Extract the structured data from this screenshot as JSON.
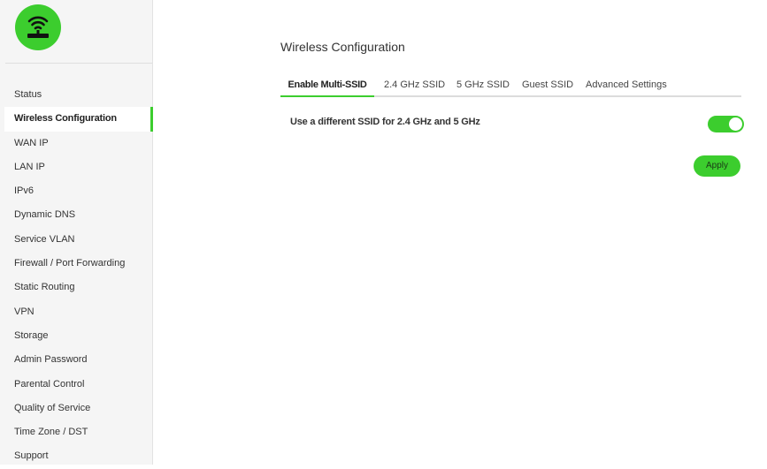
{
  "brand": {
    "logo_icon": "wifi-router-icon",
    "color": "#3ccd2e"
  },
  "sidebar": {
    "items": [
      {
        "label": "Status"
      },
      {
        "label": "Wireless Configuration",
        "active": true
      },
      {
        "label": "WAN IP"
      },
      {
        "label": "LAN IP"
      },
      {
        "label": "IPv6"
      },
      {
        "label": "Dynamic DNS"
      },
      {
        "label": "Service VLAN"
      },
      {
        "label": "Firewall / Port Forwarding"
      },
      {
        "label": "Static Routing"
      },
      {
        "label": "VPN"
      },
      {
        "label": "Storage"
      },
      {
        "label": "Admin Password"
      },
      {
        "label": "Parental Control"
      },
      {
        "label": "Quality of Service"
      },
      {
        "label": "Time Zone / DST"
      },
      {
        "label": "Support"
      }
    ]
  },
  "main": {
    "title": "Wireless Configuration",
    "tabs": [
      {
        "label": "Enable Multi-SSID",
        "active": true
      },
      {
        "label": "2.4 GHz SSID"
      },
      {
        "label": "5 GHz SSID"
      },
      {
        "label": "Guest SSID"
      },
      {
        "label": "Advanced Settings"
      }
    ],
    "setting": {
      "label": "Use a different SSID for 2.4 GHz and 5 GHz",
      "enabled": true
    },
    "apply_label": "Apply"
  },
  "colors": {
    "accent": "#3ccd2e",
    "sidebar_bg": "#f5f5f5"
  }
}
